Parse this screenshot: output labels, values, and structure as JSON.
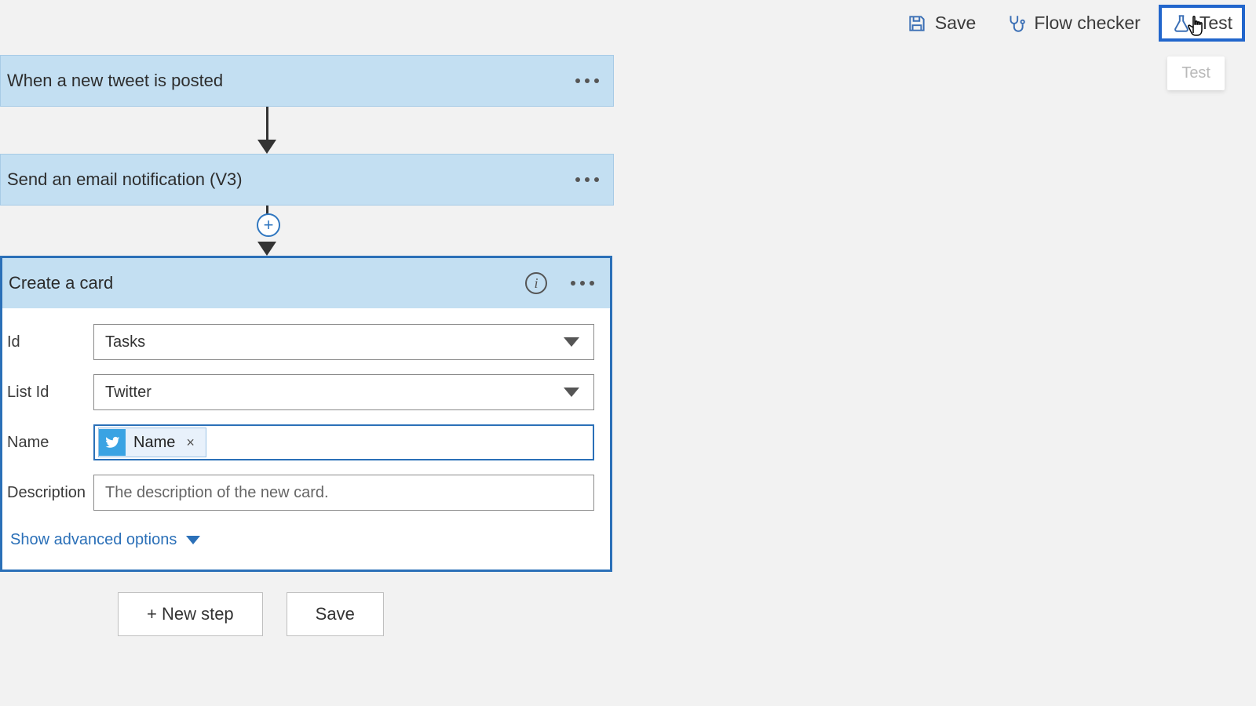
{
  "toolbar": {
    "save": "Save",
    "flow_checker": "Flow checker",
    "test": "Test",
    "test_tooltip": "Test"
  },
  "flow": {
    "trigger": {
      "title": "When a new tweet is posted"
    },
    "step1": {
      "title": "Send an email notification (V3)"
    }
  },
  "card": {
    "title": "Create a card",
    "fields": {
      "board": {
        "label": "Id",
        "value": "Tasks"
      },
      "list": {
        "label": "List Id",
        "value": "Twitter"
      },
      "name": {
        "label": "Name",
        "token": "Name"
      },
      "description": {
        "label": "Description",
        "placeholder": "The description of the new card."
      }
    },
    "advanced": "Show advanced options"
  },
  "bottom": {
    "new_step": "+ New step",
    "save": "Save"
  }
}
